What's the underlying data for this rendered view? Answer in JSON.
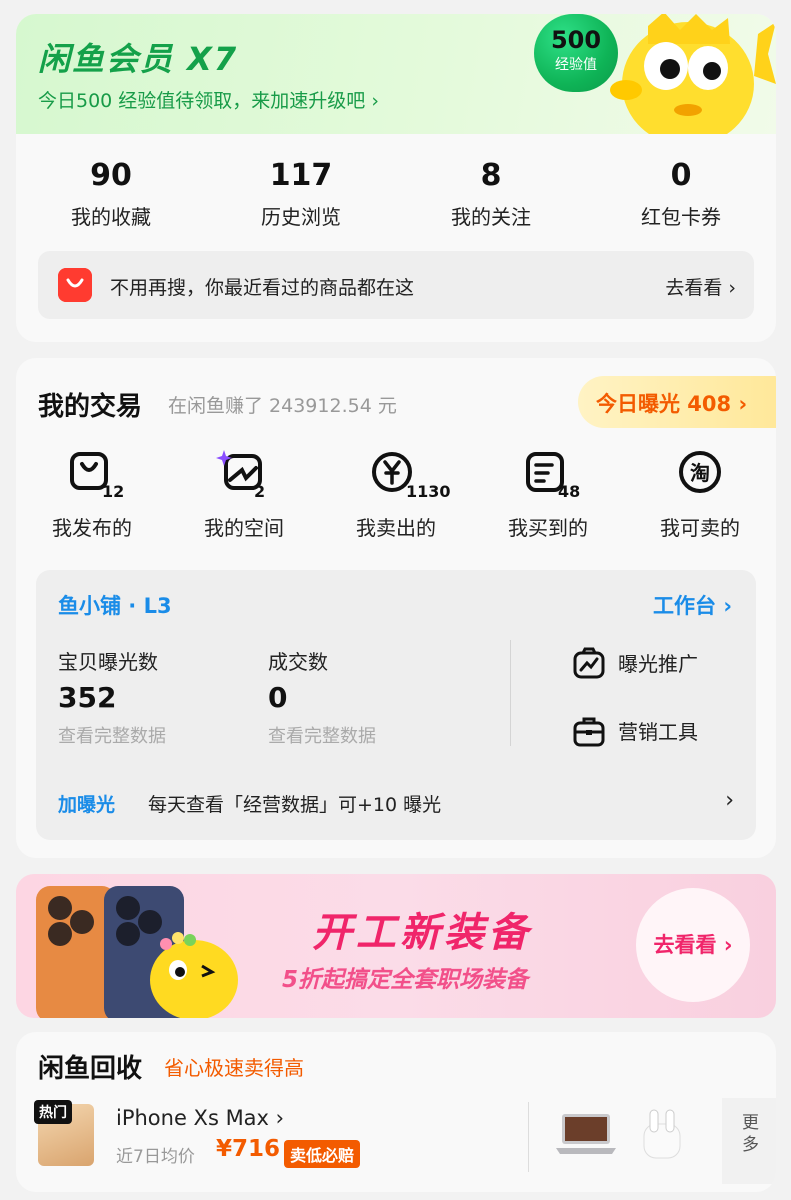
{
  "member": {
    "title": "闲鱼会员 X7",
    "subtitle": "今日500 经验值待领取，来加速升级吧 ›",
    "exp_value": "500",
    "exp_label": "经验值",
    "mascot_icon": "yellow-fish-mascot"
  },
  "stats": [
    {
      "value": "90",
      "label": "我的收藏"
    },
    {
      "value": "117",
      "label": "历史浏览"
    },
    {
      "value": "8",
      "label": "我的关注"
    },
    {
      "value": "0",
      "label": "红包卡券"
    }
  ],
  "recent": {
    "icon": "shopping-bag-icon",
    "text": "不用再搜，你最近看过的商品都在这",
    "link": "去看看 ›"
  },
  "trade": {
    "title": "我的交易",
    "earnings": "在闲鱼赚了 243912.54 元",
    "exposure": "今日曝光 408 ›",
    "items": [
      {
        "icon": "box-icon",
        "badge": "12",
        "label": "我发布的"
      },
      {
        "icon": "sparkle-space-icon",
        "badge": "2",
        "label": "我的空间"
      },
      {
        "icon": "yen-coin-icon",
        "badge": "1130",
        "label": "我卖出的"
      },
      {
        "icon": "receipt-icon",
        "badge": "48",
        "label": "我买到的"
      },
      {
        "icon": "taobao-icon",
        "badge": "",
        "label": "我可卖的"
      }
    ]
  },
  "shop": {
    "name": "鱼小铺 · L3",
    "workbench": "工作台 ›",
    "metrics": [
      {
        "label": "宝贝曝光数",
        "value": "352",
        "link": "查看完整数据"
      },
      {
        "label": "成交数",
        "value": "0",
        "link": "查看完整数据"
      }
    ],
    "tools": [
      {
        "icon": "trend-promo-icon",
        "label": "曝光推广"
      },
      {
        "icon": "briefcase-icon",
        "label": "营销工具"
      }
    ],
    "tip_tag": "加曝光",
    "tip_text": "每天查看「经营数据」可+10 曝光",
    "tip_arrow": "›"
  },
  "promo": {
    "title": "开工新装备",
    "subtitle": "5折起搞定全套职场装备",
    "button": "去看看 ›"
  },
  "recycle": {
    "title": "闲鱼回收",
    "slogan": "省心极速卖得高",
    "hot_tag": "热门",
    "product": "iPhone Xs Max ›",
    "avg_label": "近7日均价",
    "avg_price": "¥716",
    "guarantee": "卖低必赔",
    "more": "更多"
  }
}
